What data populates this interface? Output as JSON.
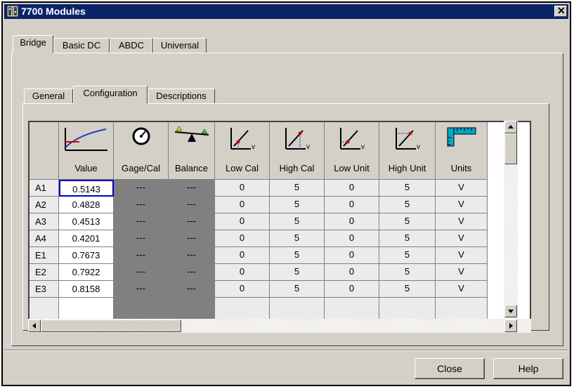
{
  "window": {
    "title": "7700 Modules",
    "close_glyph": "✕"
  },
  "outer_tabs": [
    {
      "label": "Bridge",
      "active": true
    },
    {
      "label": "Basic DC",
      "active": false
    },
    {
      "label": "ABDC",
      "active": false
    },
    {
      "label": "Universal",
      "active": false
    }
  ],
  "inner_tabs": [
    {
      "label": "General",
      "active": false
    },
    {
      "label": "Configuration",
      "active": true
    },
    {
      "label": "Descriptions",
      "active": false
    }
  ],
  "grid": {
    "columns": [
      {
        "label": "Value",
        "icon": "curve-graph-icon"
      },
      {
        "label": "Gage/Cal",
        "icon": "gauge-dial-icon"
      },
      {
        "label": "Balance",
        "icon": "balance-scale-icon"
      },
      {
        "label": "Low Cal",
        "icon": "low-cal-graph-icon"
      },
      {
        "label": "High Cal",
        "icon": "high-cal-graph-icon"
      },
      {
        "label": "Low Unit",
        "icon": "low-unit-graph-icon"
      },
      {
        "label": "High Unit",
        "icon": "high-unit-graph-icon"
      },
      {
        "label": "Units",
        "icon": "ruler-icon"
      }
    ],
    "icon_v_label": "v",
    "rows": [
      {
        "id": "A1",
        "value": "0.5143",
        "gage": "---",
        "balance": "---",
        "low_cal": "0",
        "high_cal": "5",
        "low_unit": "0",
        "high_unit": "5",
        "units": "V"
      },
      {
        "id": "A2",
        "value": "0.4828",
        "gage": "---",
        "balance": "---",
        "low_cal": "0",
        "high_cal": "5",
        "low_unit": "0",
        "high_unit": "5",
        "units": "V"
      },
      {
        "id": "A3",
        "value": "0.4513",
        "gage": "---",
        "balance": "---",
        "low_cal": "0",
        "high_cal": "5",
        "low_unit": "0",
        "high_unit": "5",
        "units": "V"
      },
      {
        "id": "A4",
        "value": "0.4201",
        "gage": "---",
        "balance": "---",
        "low_cal": "0",
        "high_cal": "5",
        "low_unit": "0",
        "high_unit": "5",
        "units": "V"
      },
      {
        "id": "E1",
        "value": "0.7673",
        "gage": "---",
        "balance": "---",
        "low_cal": "0",
        "high_cal": "5",
        "low_unit": "0",
        "high_unit": "5",
        "units": "V"
      },
      {
        "id": "E2",
        "value": "0.7922",
        "gage": "---",
        "balance": "---",
        "low_cal": "0",
        "high_cal": "5",
        "low_unit": "0",
        "high_unit": "5",
        "units": "V"
      },
      {
        "id": "E3",
        "value": "0.8158",
        "gage": "---",
        "balance": "---",
        "low_cal": "0",
        "high_cal": "5",
        "low_unit": "0",
        "high_unit": "5",
        "units": "V"
      }
    ]
  },
  "buttons": {
    "close": "Close",
    "help": "Help"
  },
  "colors": {
    "title_bar": "#0a246a",
    "face": "#d4d0c8",
    "disabled_cell": "#808080",
    "selection_border": "#0000c0"
  }
}
